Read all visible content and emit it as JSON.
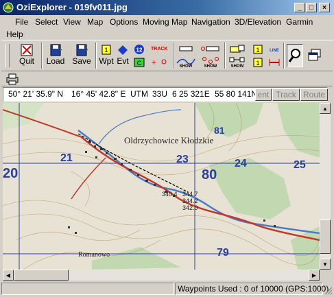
{
  "window": {
    "title": "OziExplorer - 019fv011.jpg",
    "minimize_glyph": "_",
    "maximize_glyph": "□",
    "close_glyph": "×"
  },
  "menu": [
    "File",
    "Select",
    "View",
    "Map",
    "Options",
    "Moving Map",
    "Navigation",
    "3D/Elevation",
    "Garmin",
    "Help"
  ],
  "toolbar": {
    "quit": "Quit",
    "load": "Load",
    "save": "Save",
    "wpt": "Wpt",
    "evt": "Evt",
    "track_label": "TRACK",
    "track_number": "12",
    "show": "SHOW",
    "line": "LINE",
    "c_label": "C",
    "one_label": "1"
  },
  "coords": {
    "lat": "50° 21' 35.9\" N",
    "lon": "16° 45' 42.8\" E",
    "utm_label": "UTM",
    "zone": "33U",
    "easting": "6 25 321E",
    "northing": "55 80 141N"
  },
  "coord_buttons": [
    "ent",
    "Track",
    "Route"
  ],
  "map": {
    "town_label": "Oldrzychowice Kłodzkie",
    "village_label": "Romanowo",
    "grid_numbers": [
      "20",
      "21",
      "23",
      "24",
      "25",
      "80",
      "79",
      "81"
    ],
    "spot_heights": [
      "344.7",
      "344.2",
      "342.0",
      "340.4"
    ]
  },
  "status": {
    "waypoints": "Waypoints Used : 0 of 10000  (GPS:1000)"
  },
  "colors": {
    "titlebar_start": "#0a246a",
    "titlebar_end": "#a6caf0",
    "chrome": "#d4d0c8",
    "map_paper": "#e7e2d3",
    "map_forest": "#b9d6a8",
    "map_road": "#c0392b",
    "map_river": "#4a7bc4",
    "map_grid": "#2a3f9e"
  }
}
